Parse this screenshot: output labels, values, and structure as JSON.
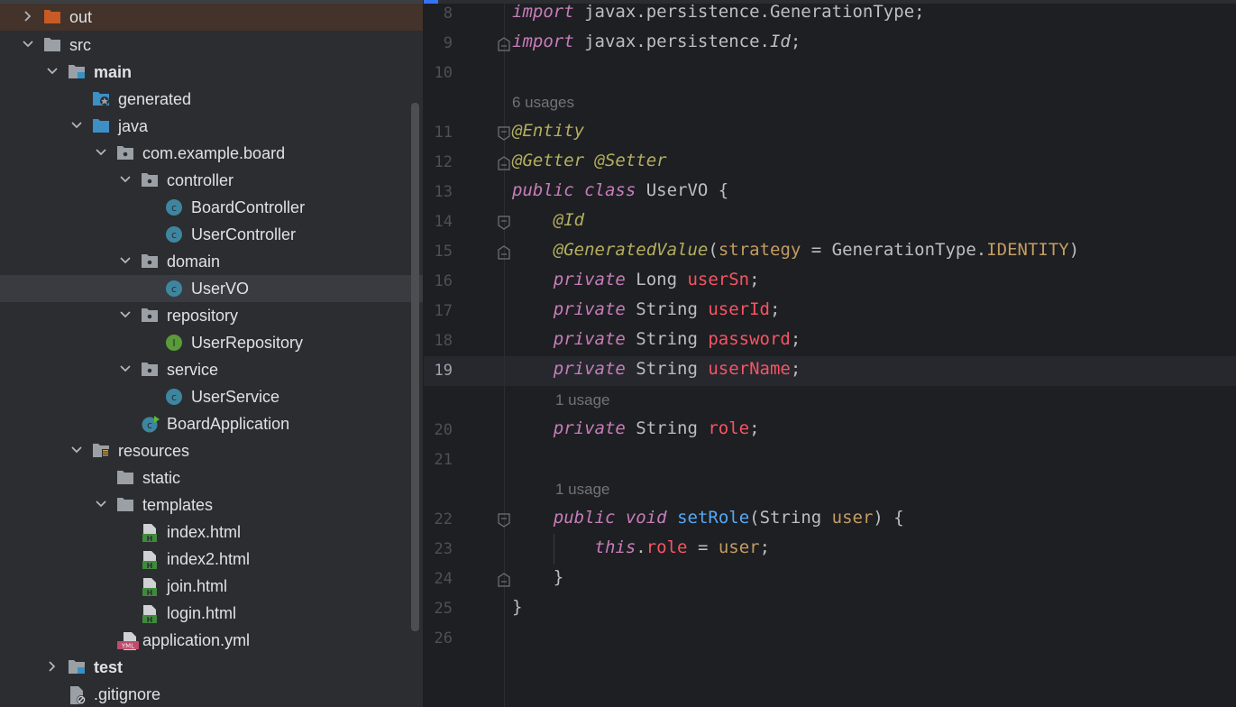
{
  "tree": {
    "rows": [
      {
        "label": "out",
        "depth": 0,
        "expanded": false,
        "icon": "folder-orange-icon",
        "bold": false
      },
      {
        "label": "src",
        "depth": 0,
        "expanded": true,
        "icon": "folder-icon",
        "bold": false
      },
      {
        "label": "main",
        "depth": 1,
        "expanded": true,
        "icon": "module-folder-icon",
        "bold": true
      },
      {
        "label": "generated",
        "depth": 2,
        "expanded": null,
        "icon": "generated-folder-icon",
        "bold": false
      },
      {
        "label": "java",
        "depth": 2,
        "expanded": true,
        "icon": "source-folder-icon",
        "bold": false
      },
      {
        "label": "com.example.board",
        "depth": 3,
        "expanded": true,
        "icon": "package-icon",
        "bold": false
      },
      {
        "label": "controller",
        "depth": 4,
        "expanded": true,
        "icon": "package-icon",
        "bold": false
      },
      {
        "label": "BoardController",
        "depth": 5,
        "expanded": null,
        "icon": "class-icon",
        "bold": false
      },
      {
        "label": "UserController",
        "depth": 5,
        "expanded": null,
        "icon": "class-icon",
        "bold": false
      },
      {
        "label": "domain",
        "depth": 4,
        "expanded": true,
        "icon": "package-icon",
        "bold": false
      },
      {
        "label": "UserVO",
        "depth": 5,
        "expanded": null,
        "icon": "class-icon",
        "bold": false,
        "selected": true
      },
      {
        "label": "repository",
        "depth": 4,
        "expanded": true,
        "icon": "package-icon",
        "bold": false
      },
      {
        "label": "UserRepository",
        "depth": 5,
        "expanded": null,
        "icon": "interface-icon",
        "bold": false
      },
      {
        "label": "service",
        "depth": 4,
        "expanded": true,
        "icon": "package-icon",
        "bold": false
      },
      {
        "label": "UserService",
        "depth": 5,
        "expanded": null,
        "icon": "class-icon",
        "bold": false
      },
      {
        "label": "BoardApplication",
        "depth": 4,
        "expanded": null,
        "icon": "spring-boot-class-icon",
        "bold": false
      },
      {
        "label": "resources",
        "depth": 2,
        "expanded": true,
        "icon": "resources-folder-icon",
        "bold": false
      },
      {
        "label": "static",
        "depth": 3,
        "expanded": null,
        "icon": "folder-icon",
        "bold": false
      },
      {
        "label": "templates",
        "depth": 3,
        "expanded": true,
        "icon": "folder-icon",
        "bold": false
      },
      {
        "label": "index.html",
        "depth": 4,
        "expanded": null,
        "icon": "html-file-icon",
        "bold": false
      },
      {
        "label": "index2.html",
        "depth": 4,
        "expanded": null,
        "icon": "html-file-icon",
        "bold": false
      },
      {
        "label": "join.html",
        "depth": 4,
        "expanded": null,
        "icon": "html-file-icon",
        "bold": false
      },
      {
        "label": "login.html",
        "depth": 4,
        "expanded": null,
        "icon": "html-file-icon",
        "bold": false
      },
      {
        "label": "application.yml",
        "depth": 3,
        "expanded": null,
        "icon": "yml-file-icon",
        "bold": false
      },
      {
        "label": "test",
        "depth": 1,
        "expanded": false,
        "icon": "module-folder-icon",
        "bold": true
      },
      {
        "label": ".gitignore",
        "depth": 1,
        "expanded": null,
        "icon": "ignored-file-icon",
        "bold": false
      }
    ]
  },
  "editor": {
    "current_line": "19",
    "lines": [
      {
        "n": "8",
        "html": "<span class=\"keyword-purple\">import</span> javax.persistence.GenerationType;"
      },
      {
        "n": "9",
        "html": "<span class=\"keyword-purple\">import</span> javax.persistence.<span class=\"itl\">Id</span>;"
      },
      {
        "n": "10",
        "html": ""
      },
      {
        "n": "11",
        "html": "<span class=\"annY\">@Entity</span>"
      },
      {
        "n": "12",
        "html": "<span class=\"annY\">@Getter</span> <span class=\"annY\">@Setter</span>"
      },
      {
        "n": "13",
        "html": "<span class=\"keyword-purple\">public class</span> UserVO {"
      },
      {
        "n": "14",
        "html": "    <span class=\"annY\">@Id</span>"
      },
      {
        "n": "15",
        "html": "    <span class=\"annY\">@GeneratedValue</span>(<span class=\"param\">strategy</span> = GenerationType.<span class=\"param\">IDENTITY</span>)"
      },
      {
        "n": "16",
        "html": "    <span class=\"keyword-purple\">private</span> Long <span class=\"var\">userSn</span>;"
      },
      {
        "n": "17",
        "html": "    <span class=\"keyword-purple\">private</span> String <span class=\"var\">userId</span>;"
      },
      {
        "n": "18",
        "html": "    <span class=\"keyword-purple\">private</span> String <span class=\"var\">password</span>;"
      },
      {
        "n": "19",
        "html": "    <span class=\"keyword-purple\">private</span> String <span class=\"var\">userName</span>;"
      },
      {
        "n": "20",
        "html": "    <span class=\"keyword-purple\">private</span> String <span class=\"var\">role</span>;"
      },
      {
        "n": "21",
        "html": ""
      },
      {
        "n": "22",
        "html": "    <span class=\"keyword-purple\">public void</span> <span class=\"blue\">setRole</span>(String <span class=\"param\">user</span>) {"
      },
      {
        "n": "23",
        "html": "        <span class=\"keyword-purple\">this</span>.<span class=\"var\">role</span> = <span class=\"param\">user</span>;"
      },
      {
        "n": "24",
        "html": "    }"
      },
      {
        "n": "25",
        "html": "}"
      },
      {
        "n": "26",
        "html": ""
      }
    ],
    "hints": {
      "class_usages": "6 usages",
      "role_usage": "1 usage",
      "setrole_usage": "1 usage"
    }
  },
  "colors": {
    "panel_bg": "#2b2d30",
    "editor_bg": "#1e1f22",
    "selection": "#393b40",
    "accent": "#3574f0"
  }
}
